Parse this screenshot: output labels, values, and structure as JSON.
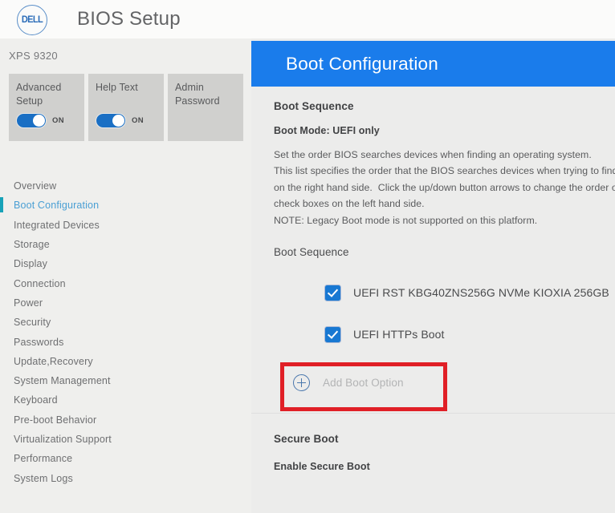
{
  "app": {
    "brand": "DELL",
    "title": "BIOS Setup",
    "model": "XPS 9320"
  },
  "tiles": [
    {
      "label": "Advanced\nSetup",
      "has_toggle": true,
      "state": "ON"
    },
    {
      "label": "Help Text",
      "has_toggle": true,
      "state": "ON"
    },
    {
      "label": "Admin\nPassword",
      "has_toggle": false,
      "state": ""
    }
  ],
  "sidebar": {
    "active": "Boot Configuration",
    "items": [
      "Overview",
      "Boot Configuration",
      "Integrated Devices",
      "Storage",
      "Display",
      "Connection",
      "Power",
      "Security",
      "Passwords",
      "Update,Recovery",
      "System Management",
      "Keyboard",
      "Pre-boot Behavior",
      "Virtualization Support",
      "Performance",
      "System Logs"
    ]
  },
  "page": {
    "header": "Boot Configuration",
    "section_title": "Boot Sequence",
    "boot_mode": "Boot Mode: UEFI only",
    "description": "Set the order BIOS searches devices when finding an operating system.\nThis list specifies the order that the BIOS searches devices when trying to find an\non the right hand side.  Click the up/down button arrows to change the order or\ncheck boxes on the left hand side.\nNOTE: Legacy Boot mode is not supported on this platform.",
    "sequence_label": "Boot Sequence",
    "boot_entries": [
      {
        "label": "UEFI RST KBG40ZNS256G NVMe KIOXIA 256GB",
        "checked": true
      },
      {
        "label": "UEFI HTTPs Boot",
        "checked": true
      }
    ],
    "add_boot_option": "Add Boot Option",
    "secure_boot_title": "Secure Boot",
    "enable_secure_boot": "Enable Secure Boot"
  },
  "colors": {
    "header_blue": "#1a7ceb",
    "accent_teal": "#17a2b8",
    "checkbox_blue": "#1878d2",
    "highlight_red": "#e01f26",
    "toggle_blue": "#1a6fc4"
  }
}
